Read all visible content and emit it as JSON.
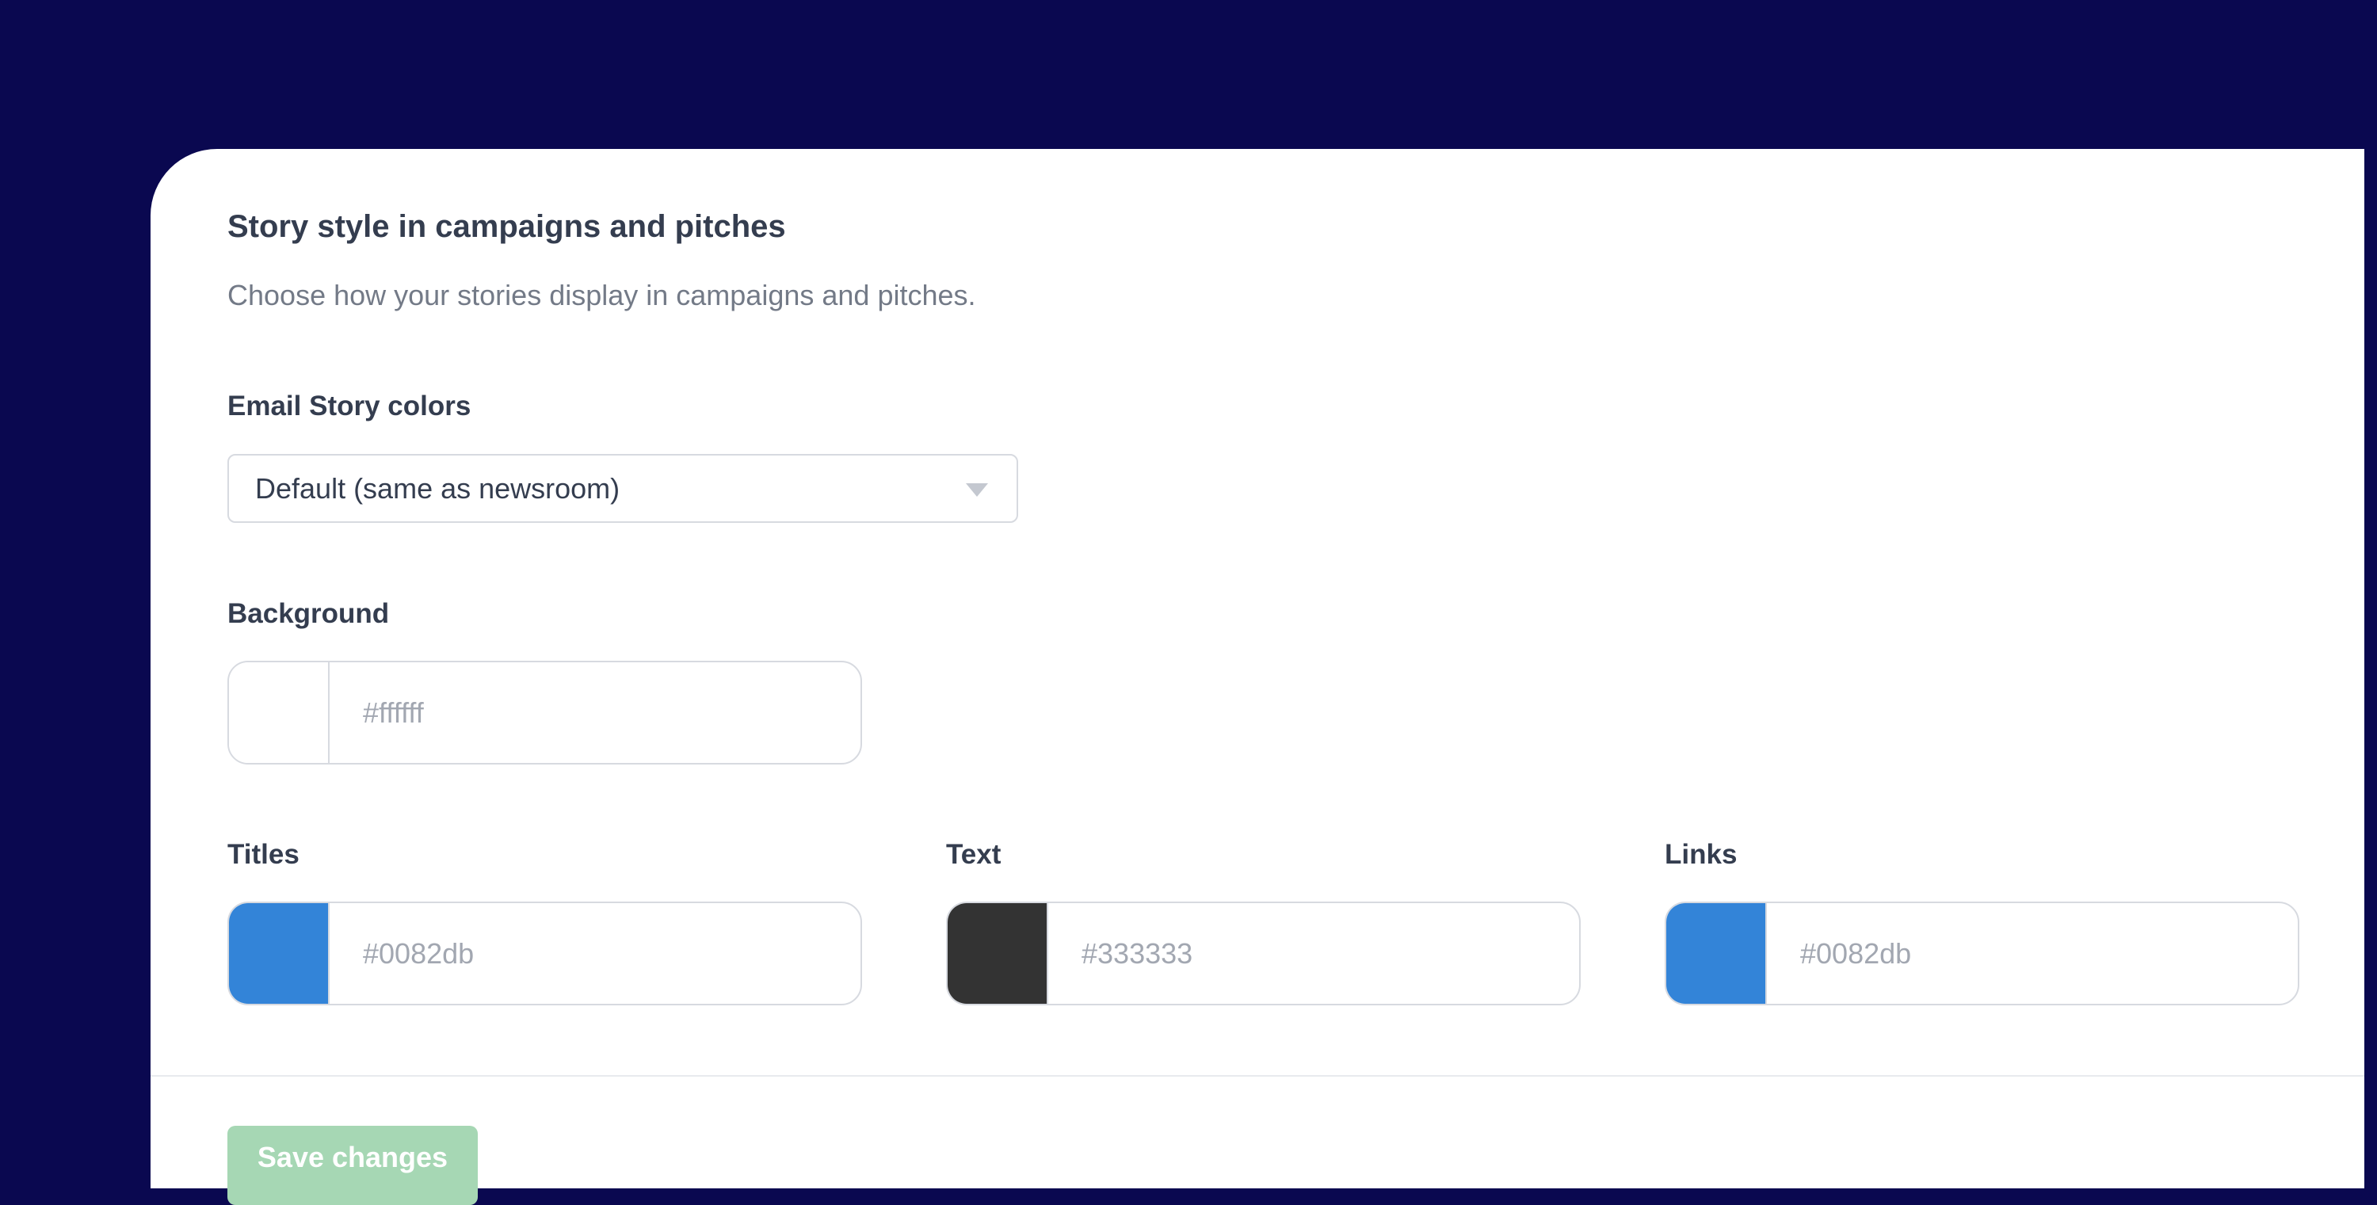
{
  "section": {
    "title": "Story style in campaigns and pitches",
    "description": "Choose how your stories display in campaigns and pitches."
  },
  "email_colors": {
    "label": "Email Story colors",
    "selected": "Default (same as newsroom)"
  },
  "background": {
    "label": "Background",
    "placeholder": "#ffffff",
    "swatch": "#ffffff"
  },
  "titles": {
    "label": "Titles",
    "placeholder": "#0082db",
    "swatch": "#3384d8"
  },
  "text": {
    "label": "Text",
    "placeholder": "#333333",
    "swatch": "#333333"
  },
  "links": {
    "label": "Links",
    "placeholder": "#0082db",
    "swatch": "#3384d8"
  },
  "actions": {
    "save_label": "Save changes"
  },
  "colors": {
    "page_background": "#0a0850",
    "card_background": "#ffffff",
    "save_button_disabled": "#a6d7b4"
  },
  "icons": {
    "select_arrow": "chevron-down-icon"
  }
}
